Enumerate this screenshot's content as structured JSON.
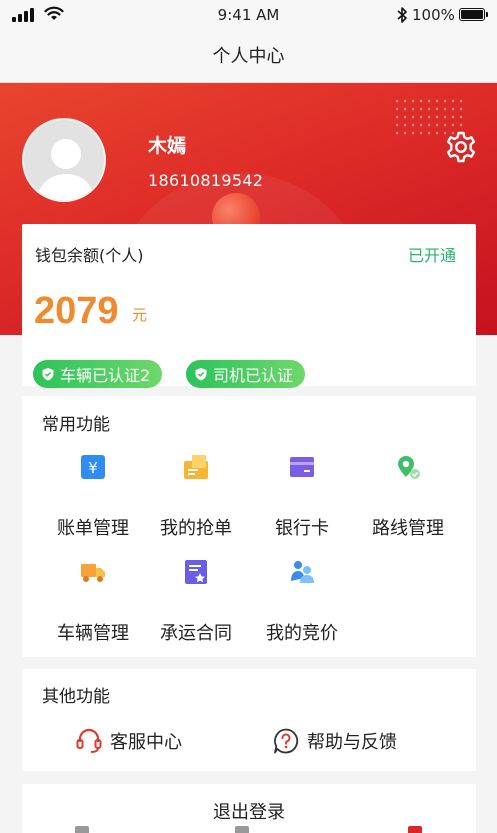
{
  "status_bar": {
    "time": "9:41 AM",
    "battery": "100%"
  },
  "nav": {
    "title": "个人中心"
  },
  "user": {
    "name": "木嫣",
    "phone": "18610819542"
  },
  "wallet": {
    "label": "钱包余额(个人)",
    "status": "已开通",
    "amount": "2079",
    "unit": "元"
  },
  "badges": [
    {
      "label": "车辆已认证2"
    },
    {
      "label": "司机已认证"
    }
  ],
  "common_functions": {
    "title": "常用功能",
    "items": [
      {
        "label": "账单管理",
        "icon": "bill-icon"
      },
      {
        "label": "我的抢单",
        "icon": "grab-order-icon"
      },
      {
        "label": "银行卡",
        "icon": "bank-card-icon"
      },
      {
        "label": "路线管理",
        "icon": "route-icon"
      },
      {
        "label": "车辆管理",
        "icon": "truck-icon"
      },
      {
        "label": "承运合同",
        "icon": "contract-icon"
      },
      {
        "label": "我的竞价",
        "icon": "bidding-icon"
      }
    ]
  },
  "other_functions": {
    "title": "其他功能",
    "items": [
      {
        "label": "客服中心",
        "icon": "headset-icon"
      },
      {
        "label": "帮助与反馈",
        "icon": "help-icon"
      }
    ]
  },
  "logout": {
    "label": "退出登录"
  },
  "colors": {
    "brand_red": "#de2a28",
    "amount_orange": "#f08a2f",
    "success_green": "#27b46e"
  }
}
